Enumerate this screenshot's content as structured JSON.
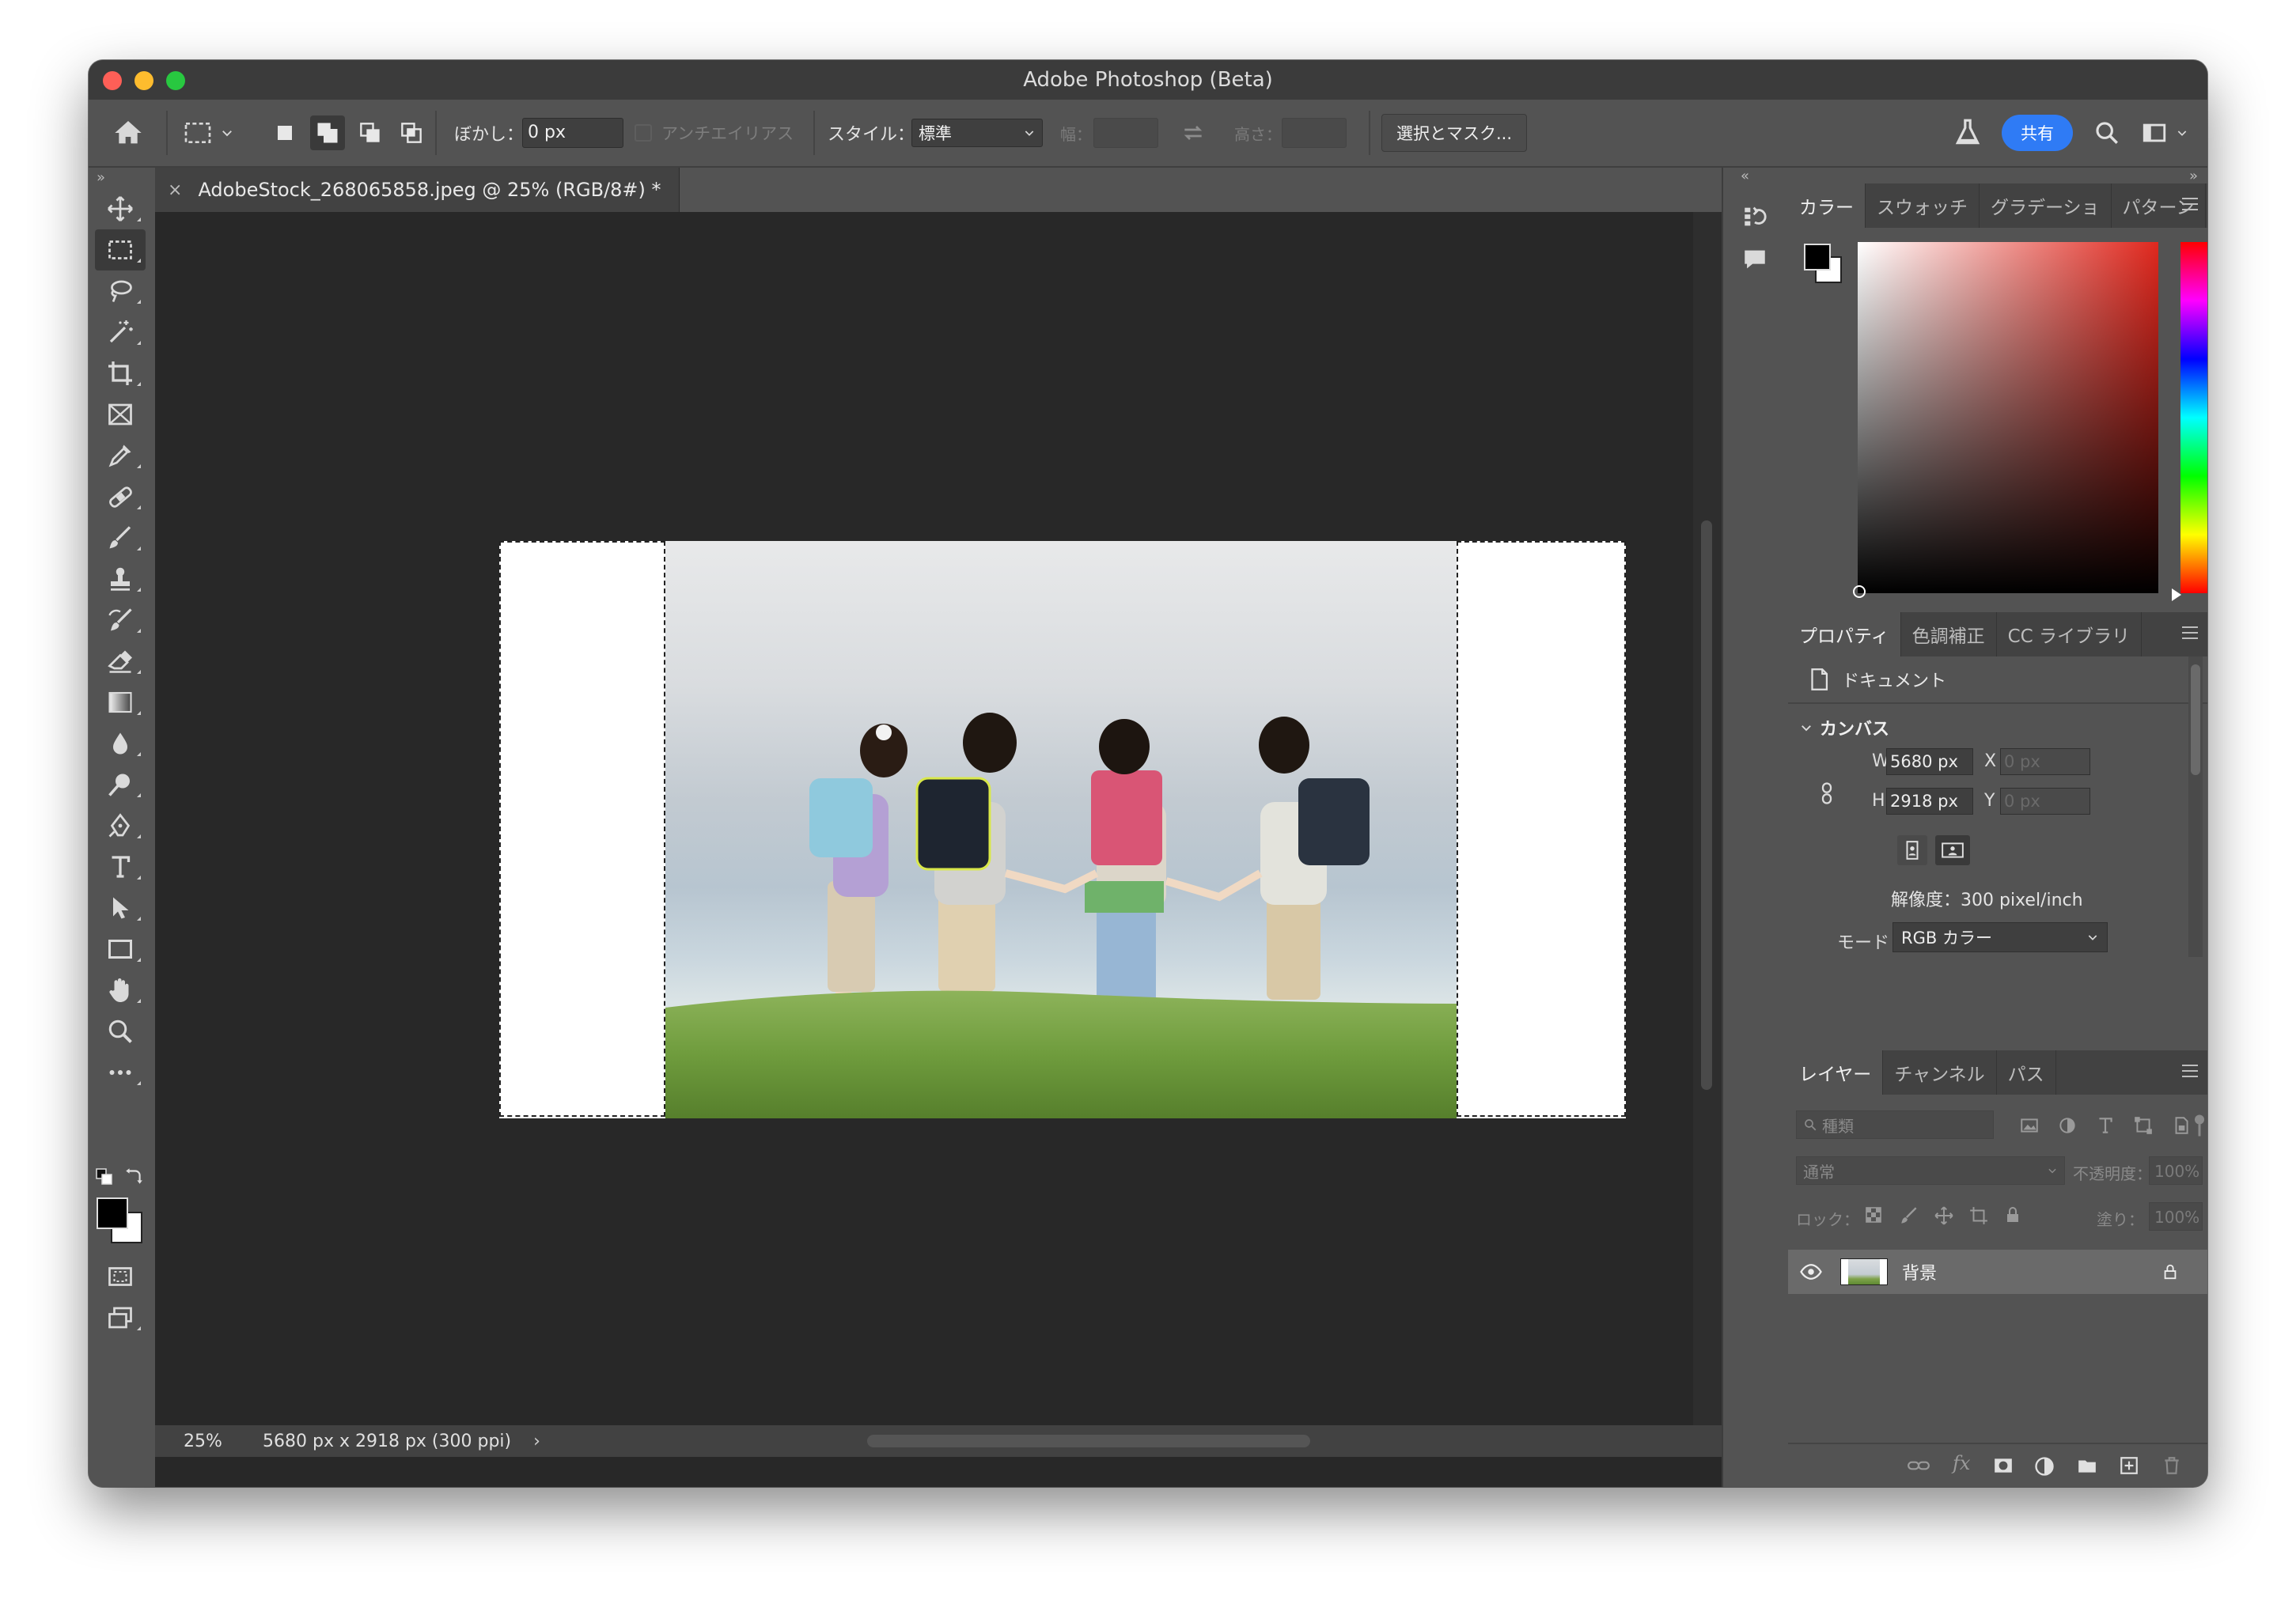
{
  "window": {
    "title": "Adobe Photoshop (Beta)"
  },
  "options": {
    "feather_label": "ぼかし：",
    "feather_value": "0 px",
    "antialias_label": "アンチエイリアス",
    "style_label": "スタイル：",
    "style_value": "標準",
    "width_label": "幅：",
    "height_label": "高さ：",
    "select_mask_label": "選択とマスク...",
    "share_label": "共有"
  },
  "document": {
    "tab_title": "AdobeStock_268065858.jpeg @ 25% (RGB/8#) *",
    "zoom": "25%",
    "dimensions": "5680 px x 2918 px (300 ppi)"
  },
  "tools": [
    "move-tool",
    "rect-marquee-tool",
    "lasso-tool",
    "magic-wand-tool",
    "crop-tool",
    "frame-tool",
    "eyedropper-tool",
    "healing-brush-tool",
    "brush-tool",
    "clone-stamp-tool",
    "history-brush-tool",
    "eraser-tool",
    "gradient-tool",
    "blur-tool",
    "dodge-tool",
    "pen-tool",
    "type-tool",
    "path-selection-tool",
    "rectangle-tool",
    "hand-tool",
    "zoom-tool",
    "more-tools"
  ],
  "color_panel": {
    "tabs": [
      "カラー",
      "スウォッチ",
      "グラデーショ",
      "パターン"
    ],
    "active_tab": 0,
    "foreground": "#000000",
    "background": "#ffffff",
    "hue_color": "#e0281e"
  },
  "properties_panel": {
    "tabs": [
      "プロパティ",
      "色調補正",
      "CC ライブラリ"
    ],
    "active_tab": 0,
    "doc_label": "ドキュメント",
    "section_label": "カンバス",
    "w_label": "W",
    "w_value": "5680 px",
    "h_label": "H",
    "h_value": "2918 px",
    "x_label": "X",
    "x_placeholder": "0 px",
    "y_label": "Y",
    "y_placeholder": "0 px",
    "resolution": "解像度：300 pixel/inch",
    "mode_label": "モード",
    "mode_value": "RGB カラー"
  },
  "layers_panel": {
    "tabs": [
      "レイヤー",
      "チャンネル",
      "パス"
    ],
    "active_tab": 0,
    "search_placeholder": "種類",
    "blend_mode": "通常",
    "opacity_label": "不透明度：",
    "opacity_value": "100%",
    "lock_label": "ロック：",
    "fill_label": "塗り：",
    "fill_value": "100%",
    "layers": [
      {
        "name": "背景",
        "visible": true,
        "locked": true
      }
    ]
  }
}
